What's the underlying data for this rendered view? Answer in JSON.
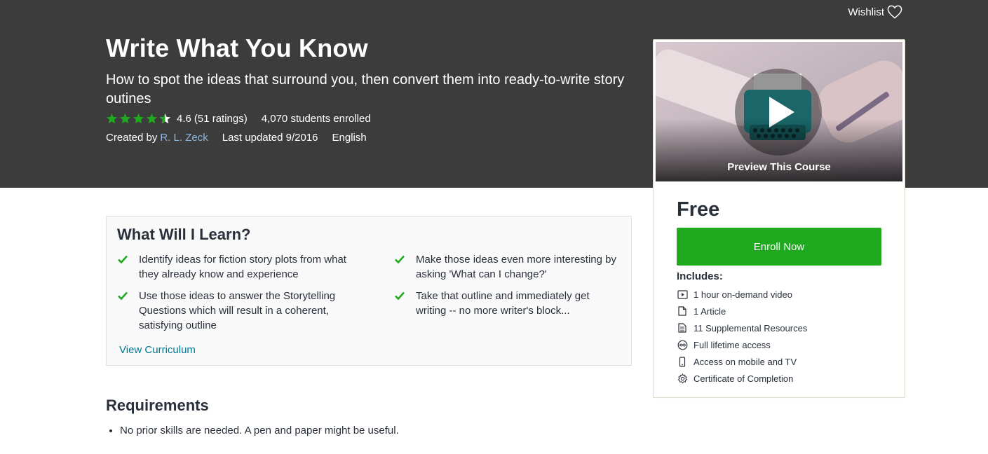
{
  "header": {
    "wishlist_label": "Wishlist",
    "title": "Write What You Know",
    "subtitle": "How to spot the ideas that surround you, then convert them into ready-to-write story outines",
    "rating": {
      "value": "4.6",
      "count_text": "(51 ratings)",
      "stars": 4.5,
      "star_color": "#1ea91e"
    },
    "enrolled": "4,070 students enrolled",
    "created_by_label": "Created by",
    "author": "R. L. Zeck",
    "last_updated": "Last updated 9/2016",
    "language": "English"
  },
  "sidebar": {
    "preview_label": "Preview This Course",
    "price": "Free",
    "enroll_label": "Enroll Now",
    "enroll_color": "#1ea91e",
    "includes_title": "Includes:",
    "includes": [
      {
        "icon": "video-icon",
        "label": "1 hour on-demand video"
      },
      {
        "icon": "article-icon",
        "label": "1 Article"
      },
      {
        "icon": "resources-icon",
        "label": "11 Supplemental Resources"
      },
      {
        "icon": "infinity-icon",
        "label": "Full lifetime access"
      },
      {
        "icon": "mobile-icon",
        "label": "Access on mobile and TV"
      },
      {
        "icon": "certificate-icon",
        "label": "Certificate of Completion"
      }
    ]
  },
  "learn": {
    "title": "What Will I Learn?",
    "items": [
      "Identify ideas for fiction story plots from what they already know and experience",
      "Make those ideas even more interesting by asking 'What can I change?'",
      "Use those ideas to answer the Storytelling Questions which will result in a coherent, satisfying outline",
      "Take that outline and immediately get writing -- no more writer's block..."
    ],
    "curriculum_link": "View Curriculum"
  },
  "requirements": {
    "title": "Requirements",
    "items": [
      "No prior skills are needed. A pen and paper might be useful."
    ]
  }
}
